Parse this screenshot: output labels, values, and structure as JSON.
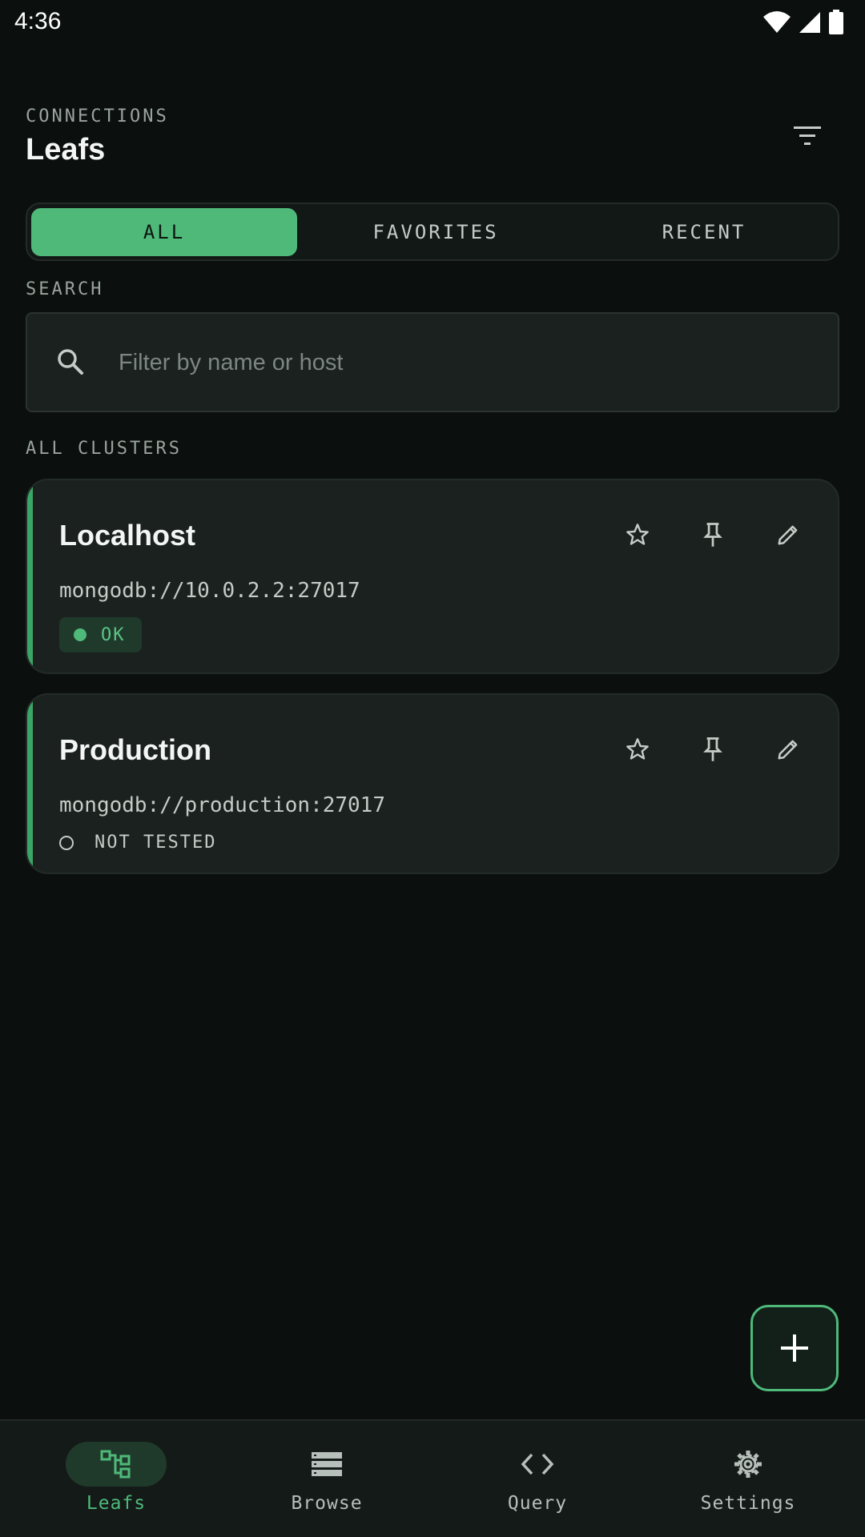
{
  "status_bar": {
    "time": "4:36"
  },
  "header": {
    "overline": "CONNECTIONS",
    "title": "Leafs",
    "filter_icon": "filter-list-icon"
  },
  "tabs": [
    {
      "label": "ALL",
      "active": true
    },
    {
      "label": "FAVORITES",
      "active": false
    },
    {
      "label": "RECENT",
      "active": false
    }
  ],
  "search": {
    "label": "SEARCH",
    "placeholder": "Filter by name or host",
    "value": ""
  },
  "clusters_label": "ALL CLUSTERS",
  "clusters": [
    {
      "name": "Localhost",
      "uri": "mongodb://10.0.2.2:27017",
      "status": "OK"
    },
    {
      "name": "Production",
      "uri": "mongodb://production:27017",
      "status": "NOT TESTED"
    }
  ],
  "fab": {
    "icon": "plus-icon"
  },
  "bottom_nav": [
    {
      "label": "Leafs",
      "icon": "tree-icon",
      "active": true
    },
    {
      "label": "Browse",
      "icon": "list-icon",
      "active": false
    },
    {
      "label": "Query",
      "icon": "code-icon",
      "active": false
    },
    {
      "label": "Settings",
      "icon": "gear-icon",
      "active": false
    }
  ],
  "colors": {
    "accent": "#4fb97a",
    "background": "#0b100e",
    "card": "#1a211e"
  }
}
